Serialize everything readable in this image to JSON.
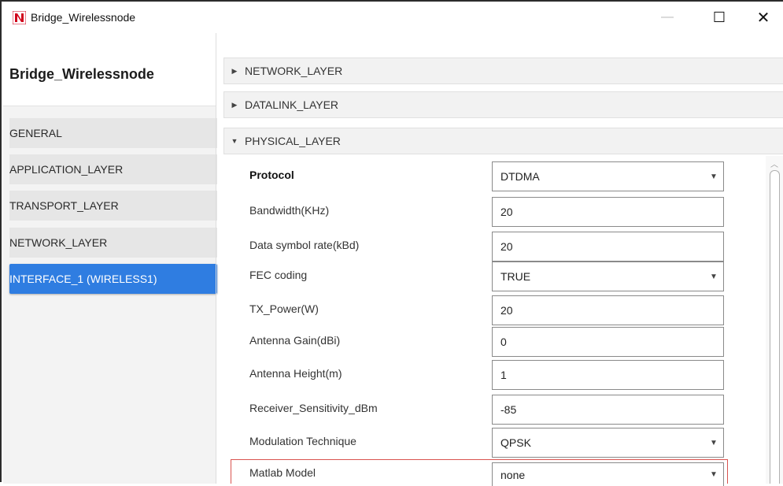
{
  "window": {
    "title": "Bridge_Wirelessnode",
    "minimize_glyph": "—",
    "maximize_glyph": "☐",
    "close_glyph": "✕"
  },
  "sidebar": {
    "title": "Bridge_Wirelessnode",
    "items": [
      {
        "label": "GENERAL",
        "active": false
      },
      {
        "label": "APPLICATION_LAYER",
        "active": false
      },
      {
        "label": "TRANSPORT_LAYER",
        "active": false
      },
      {
        "label": "NETWORK_LAYER",
        "active": false
      },
      {
        "label": "INTERFACE_1 (WIRELESS1)",
        "active": true
      }
    ]
  },
  "sections": [
    {
      "label": "NETWORK_LAYER",
      "expanded": false,
      "arrow": "▶"
    },
    {
      "label": "DATALINK_LAYER",
      "expanded": false,
      "arrow": "▶"
    },
    {
      "label": "PHYSICAL_LAYER",
      "expanded": true,
      "arrow": "▼"
    }
  ],
  "physical_layer": {
    "rows": [
      {
        "label": "Protocol",
        "value": "DTDMA",
        "type": "dropdown"
      },
      {
        "label": "Bandwidth(KHz)",
        "value": "20",
        "type": "text"
      },
      {
        "label": "Data symbol rate(kBd)",
        "value": "20",
        "type": "text"
      },
      {
        "label": "FEC coding",
        "value": "TRUE",
        "type": "dropdown"
      },
      {
        "label": "TX_Power(W)",
        "value": "20",
        "type": "text"
      },
      {
        "label": "Antenna Gain(dBi)",
        "value": "0",
        "type": "text"
      },
      {
        "label": "Antenna Height(m)",
        "value": "1",
        "type": "text"
      },
      {
        "label": "Receiver_Sensitivity_dBm",
        "value": "-85",
        "type": "text"
      },
      {
        "label": "Modulation Technique",
        "value": "QPSK",
        "type": "dropdown"
      },
      {
        "label": "Matlab Model",
        "value": "none",
        "type": "dropdown"
      }
    ],
    "dropdown_glyph": "▼",
    "scroll_up_glyph": "︿"
  },
  "colors": {
    "accent": "#2f7de1",
    "highlight_border": "#d9534f",
    "logo_red": "#d0021b"
  }
}
